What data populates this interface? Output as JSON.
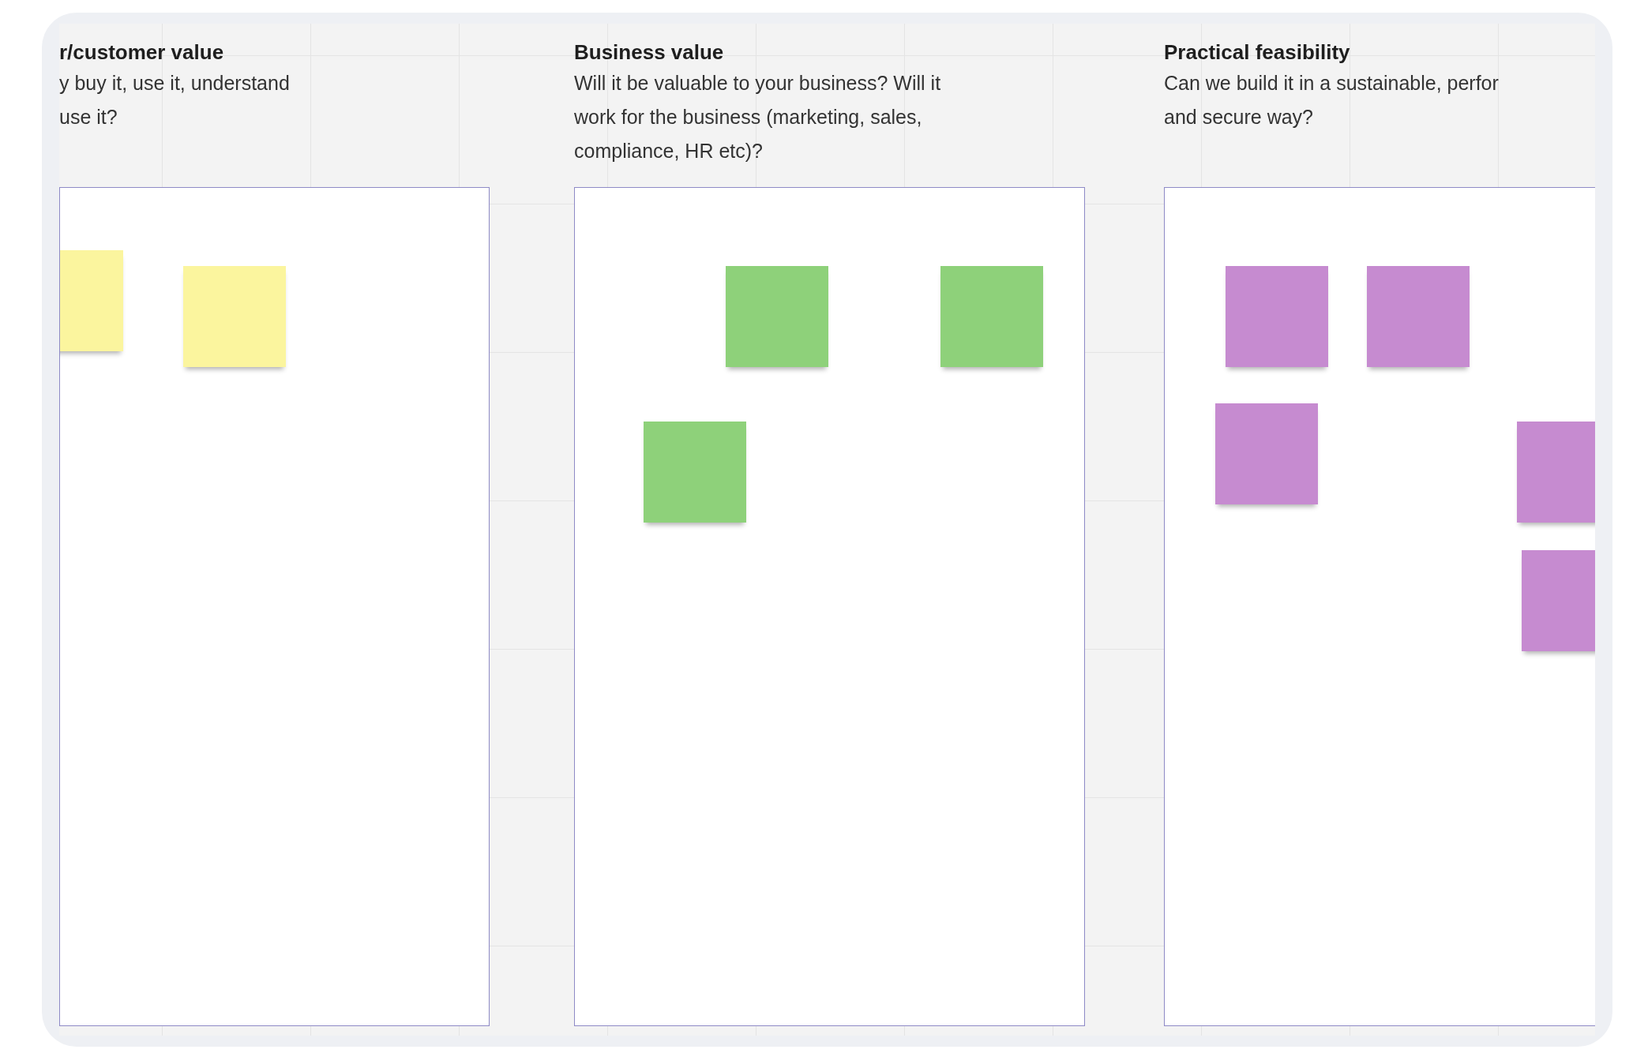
{
  "columns": [
    {
      "title": "r/customer value",
      "lines": [
        "y buy it, use it, understand",
        "use it?"
      ],
      "notes": [
        {
          "color": "#fbf59e"
        },
        {
          "color": "#fbf59e"
        }
      ]
    },
    {
      "title": "Business value",
      "lines": [
        "Will it be valuable to your business? Will it",
        "work for the business (marketing, sales,",
        "compliance, HR etc)?"
      ],
      "notes": [
        {
          "color": "#8ed17a"
        },
        {
          "color": "#8ed17a"
        },
        {
          "color": "#8ed17a"
        }
      ]
    },
    {
      "title": "Practical feasibility",
      "lines": [
        "Can we build it in a sustainable, perfor",
        "and secure way?"
      ],
      "notes": [
        {
          "color": "#c68bd0"
        },
        {
          "color": "#c68bd0"
        },
        {
          "color": "#c68bd0"
        },
        {
          "color": "#c68bd0"
        },
        {
          "color": "#c68bd0"
        }
      ]
    }
  ]
}
